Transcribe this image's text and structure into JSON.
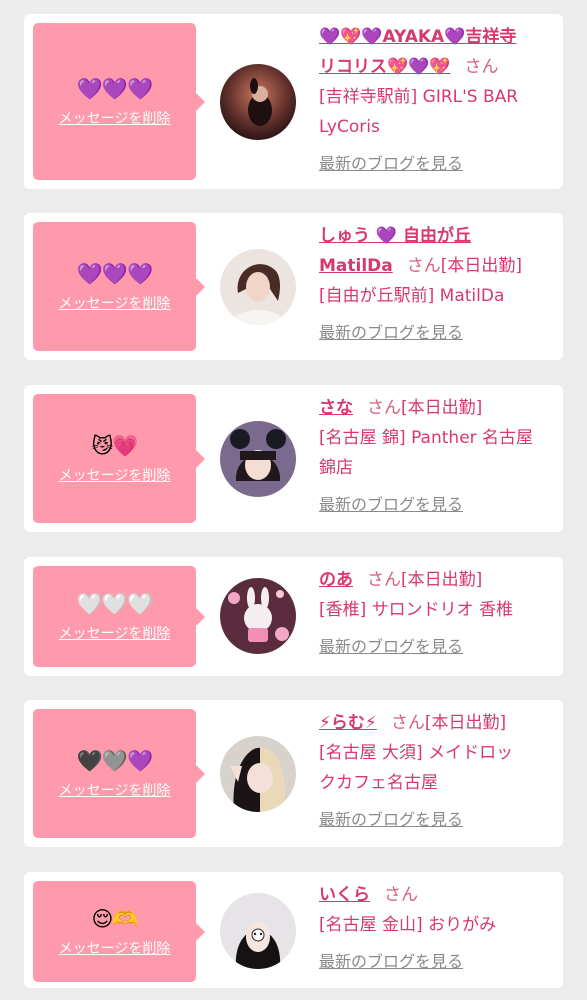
{
  "delete_label": "メッセージを削除",
  "san_label": "さん",
  "blog_label": "最新のブログを見る",
  "colors": {
    "page_bg": "#ececec",
    "card_bg": "#ffffff",
    "accent_pink": "#ff9aac",
    "name_text": "#d83870",
    "link_gray": "#8a8a8a"
  },
  "cards": [
    {
      "emojis": [
        "💜",
        "💜",
        "💜"
      ],
      "name_line1": "💜💖💜AYAKA💜吉祥寺",
      "name_line2": "リコリス💖💜💖",
      "shop_line1": "[吉祥寺駅前] GIRL'S BAR",
      "shop_line2": "LyCoris",
      "avatar_icon": "avatar-photo-icon"
    },
    {
      "emojis": [
        "💜",
        "💜",
        "💜"
      ],
      "name_line1": "しゅう 💜 自由が丘",
      "name_line2": "MatilDa",
      "status": "[本日出勤]",
      "shop_line1": "[自由が丘駅前] MatilDa",
      "avatar_icon": "avatar-photo-icon"
    },
    {
      "emojis": [
        "😼",
        "💗"
      ],
      "name_line1": "さな",
      "status": "[本日出勤]",
      "shop_line1": "[名古屋 錦] Panther 名古屋",
      "shop_line2": "錦店",
      "avatar_icon": "avatar-photo-icon"
    },
    {
      "emojis": [
        "🤍",
        "🤍",
        "🤍"
      ],
      "name_line1": "のあ",
      "status": "[本日出勤]",
      "shop_line1": "[香椎] サロンドリオ 香椎",
      "avatar_icon": "avatar-photo-icon"
    },
    {
      "emojis": [
        "🖤",
        "🩶",
        "💜"
      ],
      "name_line1": "⚡らむ⚡",
      "status": "[本日出勤]",
      "shop_line1": "[名古屋 大須] メイドロッ",
      "shop_line2": "クカフェ名古屋",
      "avatar_icon": "avatar-photo-icon"
    },
    {
      "emojis": [
        "😌",
        "🫶"
      ],
      "name_line1": "いくら",
      "shop_line1": "[名古屋 金山] おりがみ",
      "avatar_icon": "avatar-photo-icon"
    }
  ]
}
